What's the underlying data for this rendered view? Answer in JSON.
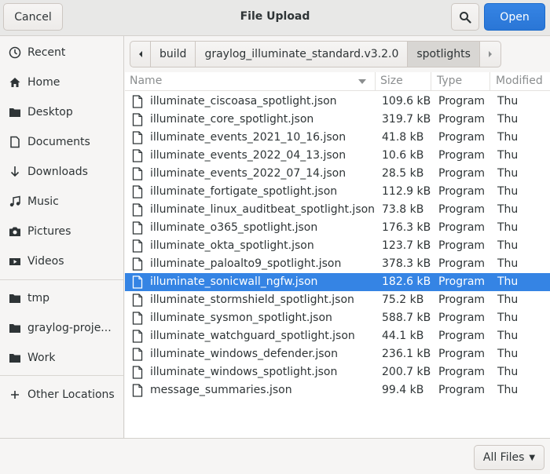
{
  "header": {
    "title": "File Upload",
    "cancel_label": "Cancel",
    "open_label": "Open",
    "search_icon": "search-icon"
  },
  "sidebar": {
    "items": [
      {
        "label": "Recent",
        "icon": "clock-icon"
      },
      {
        "label": "Home",
        "icon": "home-icon"
      },
      {
        "label": "Desktop",
        "icon": "folder-icon"
      },
      {
        "label": "Documents",
        "icon": "document-icon"
      },
      {
        "label": "Downloads",
        "icon": "download-icon"
      },
      {
        "label": "Music",
        "icon": "music-icon"
      },
      {
        "label": "Pictures",
        "icon": "camera-icon"
      },
      {
        "label": "Videos",
        "icon": "video-icon"
      },
      {
        "label": "tmp",
        "icon": "folder-icon"
      },
      {
        "label": "graylog-proje...",
        "icon": "folder-icon"
      },
      {
        "label": "Work",
        "icon": "folder-icon"
      },
      {
        "label": "Other Locations",
        "icon": "plus-icon"
      }
    ]
  },
  "pathbar": {
    "segments": [
      "build",
      "graylog_illuminate_standard.v3.2.0",
      "spotlights"
    ],
    "active_index": 2
  },
  "columns": {
    "name": "Name",
    "size": "Size",
    "type": "Type",
    "modified": "Modified"
  },
  "files": [
    {
      "name": "illuminate_ciscoasa_spotlight.json",
      "size": "109.6 kB",
      "type": "Program",
      "modified": "Thu"
    },
    {
      "name": "illuminate_core_spotlight.json",
      "size": "319.7 kB",
      "type": "Program",
      "modified": "Thu"
    },
    {
      "name": "illuminate_events_2021_10_16.json",
      "size": "41.8 kB",
      "type": "Program",
      "modified": "Thu"
    },
    {
      "name": "illuminate_events_2022_04_13.json",
      "size": "10.6 kB",
      "type": "Program",
      "modified": "Thu"
    },
    {
      "name": "illuminate_events_2022_07_14.json",
      "size": "28.5 kB",
      "type": "Program",
      "modified": "Thu"
    },
    {
      "name": "illuminate_fortigate_spotlight.json",
      "size": "112.9 kB",
      "type": "Program",
      "modified": "Thu"
    },
    {
      "name": "illuminate_linux_auditbeat_spotlight.json",
      "size": "73.8 kB",
      "type": "Program",
      "modified": "Thu"
    },
    {
      "name": "illuminate_o365_spotlight.json",
      "size": "176.3 kB",
      "type": "Program",
      "modified": "Thu"
    },
    {
      "name": "illuminate_okta_spotlight.json",
      "size": "123.7 kB",
      "type": "Program",
      "modified": "Thu"
    },
    {
      "name": "illuminate_paloalto9_spotlight.json",
      "size": "378.3 kB",
      "type": "Program",
      "modified": "Thu"
    },
    {
      "name": "illuminate_sonicwall_ngfw.json",
      "size": "182.6 kB",
      "type": "Program",
      "modified": "Thu"
    },
    {
      "name": "illuminate_stormshield_spotlight.json",
      "size": "75.2 kB",
      "type": "Program",
      "modified": "Thu"
    },
    {
      "name": "illuminate_sysmon_spotlight.json",
      "size": "588.7 kB",
      "type": "Program",
      "modified": "Thu"
    },
    {
      "name": "illuminate_watchguard_spotlight.json",
      "size": "44.1 kB",
      "type": "Program",
      "modified": "Thu"
    },
    {
      "name": "illuminate_windows_defender.json",
      "size": "236.1 kB",
      "type": "Program",
      "modified": "Thu"
    },
    {
      "name": "illuminate_windows_spotlight.json",
      "size": "200.7 kB",
      "type": "Program",
      "modified": "Thu"
    },
    {
      "name": "message_summaries.json",
      "size": "99.4 kB",
      "type": "Program",
      "modified": "Thu"
    }
  ],
  "selected_index": 10,
  "filter": {
    "label": "All Files"
  },
  "colors": {
    "accent": "#3584e4"
  }
}
